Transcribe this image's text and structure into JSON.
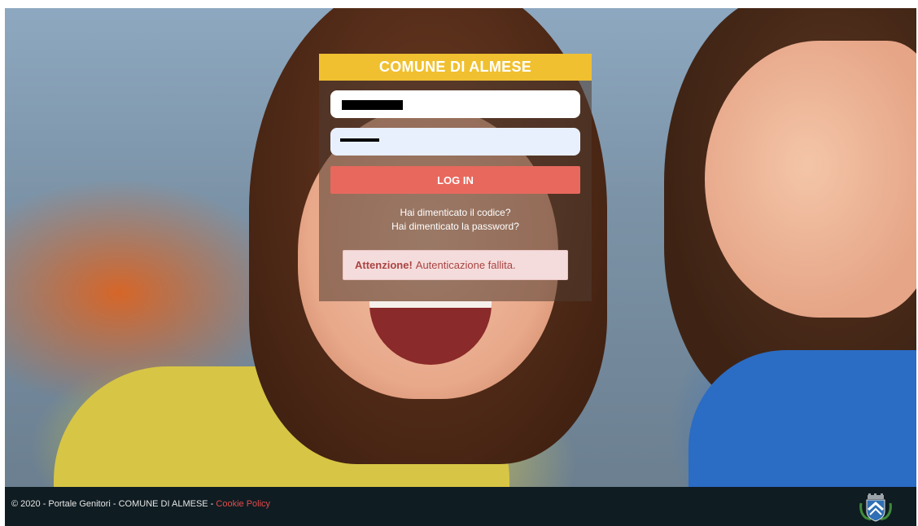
{
  "panel": {
    "title": "COMUNE DI ALMESE",
    "username_value": "",
    "password_value": "",
    "login_label": "LOG IN",
    "forgot_code": "Hai dimenticato il codice?",
    "forgot_password": "Hai dimenticato la password?",
    "alert_strong": "Attenzione!",
    "alert_message": "Autenticazione fallita."
  },
  "footer": {
    "text": "© 2020 - Portale Genitori - COMUNE DI ALMESE - ",
    "cookie_link": "Cookie Policy"
  },
  "colors": {
    "title_bar": "#f0c030",
    "login_button": "#e8685e",
    "alert_bg": "#f5dcdc",
    "alert_text": "#a94442",
    "footer_bg": "#0f1c22",
    "footer_link": "#e34b4b"
  },
  "icons": {
    "crest": "municipal-crest-icon"
  }
}
